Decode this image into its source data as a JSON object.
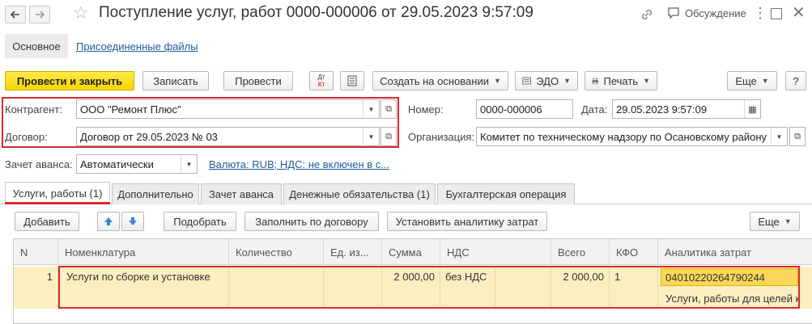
{
  "window": {
    "title": "Поступление услуг, работ 0000-000006 от 29.05.2023 9:57:09",
    "discussion_label": "Обсуждение"
  },
  "nav": {
    "main_tab": "Основное",
    "files_link": "Присоединенные файлы"
  },
  "toolbar": {
    "post_close": "Провести и закрыть",
    "save": "Записать",
    "post": "Провести",
    "create_based": "Создать на основании",
    "edo": "ЭДО",
    "print": "Печать",
    "more": "Еще",
    "help": "?"
  },
  "form": {
    "counterparty_label": "Контрагент:",
    "counterparty_value": "ООО \"Ремонт Плюс\"",
    "contract_label": "Договор:",
    "contract_value": "Договор от 29.05.2023 № 03",
    "number_label": "Номер:",
    "number_value": "0000-000006",
    "date_label": "Дата:",
    "date_value": "29.05.2023  9:57:09",
    "org_label": "Организация:",
    "org_value": "Комитет по техническому надзору по Осановскому району",
    "advance_label": "Зачет аванса:",
    "advance_value": "Автоматически",
    "currency_link": "Валюта: RUB; НДС: не включен в с..."
  },
  "tabs": [
    {
      "label": "Услуги, работы (1)"
    },
    {
      "label": "Дополнительно"
    },
    {
      "label": "Зачет аванса"
    },
    {
      "label": "Денежные обязательства (1)"
    },
    {
      "label": "Бухгалтерская операция"
    }
  ],
  "table_toolbar": {
    "add": "Добавить",
    "pick": "Подобрать",
    "fill_contract": "Заполнить по договору",
    "set_analytics": "Установить аналитику затрат",
    "more": "Еще"
  },
  "table": {
    "columns": [
      "N",
      "Номенклатура",
      "Количество",
      "Ед. из...",
      "Сумма",
      "НДС",
      "Всего",
      "КФО",
      "Аналитика затрат"
    ],
    "rows": [
      {
        "n": "1",
        "item": "Услуги по сборке и установке",
        "qty": "",
        "unit": "",
        "sum": "2 000,00",
        "vat": "без НДС",
        "total": "2 000,00",
        "kfo": "1",
        "analytics_code": "04010220264790244",
        "analytics_desc": "Услуги, работы для целей к"
      }
    ]
  },
  "colors": {
    "accent_red": "#d9292e",
    "primary_yellow": "#f5d600",
    "row_highlight": "#fbefc2",
    "link_blue": "#1f5b9e"
  }
}
